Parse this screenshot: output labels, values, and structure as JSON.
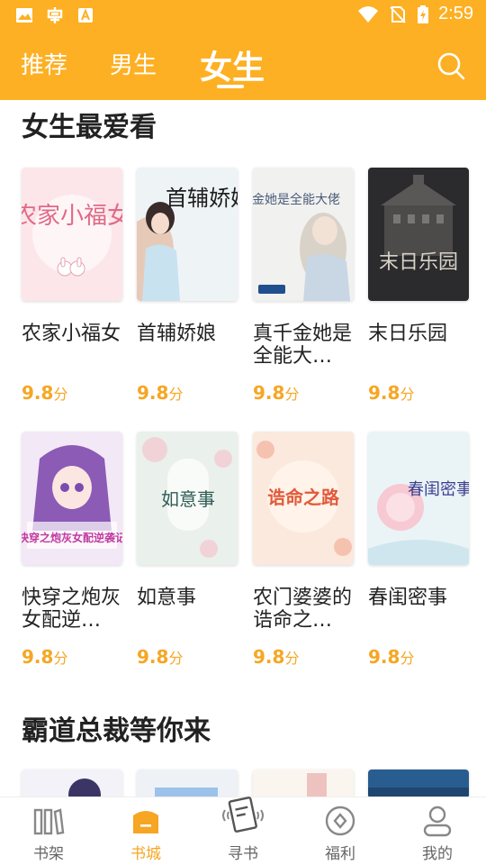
{
  "statusbar": {
    "time": "2:59"
  },
  "tabs": [
    {
      "label": "推荐",
      "active": false
    },
    {
      "label": "男生",
      "active": false
    },
    {
      "label": "女生",
      "active": true
    }
  ],
  "sections": [
    {
      "title": "女生最爱看",
      "books": [
        {
          "title": "农家小福女",
          "score": "9.8",
          "unit": "分",
          "cover_text": "农家小福女"
        },
        {
          "title": "首辅娇娘",
          "score": "9.8",
          "unit": "分",
          "cover_text": "首辅娇娘"
        },
        {
          "title": "真千金她是全能大…",
          "score": "9.8",
          "unit": "分",
          "cover_text": "真千金她是全能大佬"
        },
        {
          "title": "末日乐园",
          "score": "9.8",
          "unit": "分",
          "cover_text": "末日乐园"
        },
        {
          "title": "快穿之炮灰女配逆…",
          "score": "9.8",
          "unit": "分",
          "cover_text": "快穿之炮灰女配逆袭记"
        },
        {
          "title": "如意事",
          "score": "9.8",
          "unit": "分",
          "cover_text": "如意事"
        },
        {
          "title": "农门婆婆的诰命之…",
          "score": "9.8",
          "unit": "分",
          "cover_text": "诰命之路"
        },
        {
          "title": "春闺密事",
          "score": "9.8",
          "unit": "分",
          "cover_text": "春闺密事"
        }
      ]
    },
    {
      "title": "霸道总裁等你来"
    }
  ],
  "bottom_nav": [
    {
      "label": "书架",
      "icon": "bookshelf-icon",
      "active": false
    },
    {
      "label": "书城",
      "icon": "bookstore-icon",
      "active": true
    },
    {
      "label": "寻书",
      "icon": "find-book-icon",
      "active": false
    },
    {
      "label": "福利",
      "icon": "welfare-icon",
      "active": false
    },
    {
      "label": "我的",
      "icon": "profile-icon",
      "active": false
    }
  ],
  "colors": {
    "accent": "#fdb023",
    "score": "#f6a623",
    "text": "#222222"
  }
}
